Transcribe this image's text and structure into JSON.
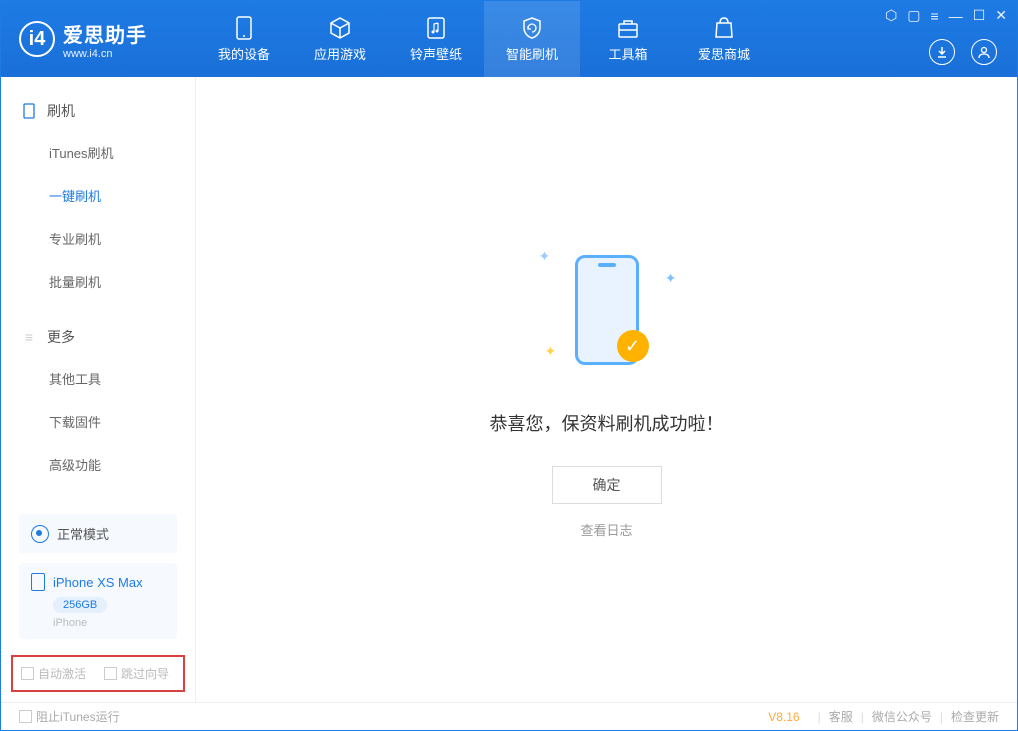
{
  "logo": {
    "title": "爱思助手",
    "subtitle": "www.i4.cn",
    "badge": "i4"
  },
  "nav": {
    "items": [
      {
        "label": "我的设备"
      },
      {
        "label": "应用游戏"
      },
      {
        "label": "铃声壁纸"
      },
      {
        "label": "智能刷机"
      },
      {
        "label": "工具箱"
      },
      {
        "label": "爱思商城"
      }
    ]
  },
  "sidebar": {
    "group1": {
      "title": "刷机",
      "items": [
        {
          "label": "iTunes刷机"
        },
        {
          "label": "一键刷机"
        },
        {
          "label": "专业刷机"
        },
        {
          "label": "批量刷机"
        }
      ]
    },
    "group2": {
      "title": "更多",
      "items": [
        {
          "label": "其他工具"
        },
        {
          "label": "下载固件"
        },
        {
          "label": "高级功能"
        }
      ]
    },
    "mode": "正常模式",
    "device": {
      "name": "iPhone XS Max",
      "storage": "256GB",
      "type": "iPhone"
    },
    "checks": {
      "auto_activate": "自动激活",
      "skip_guide": "跳过向导"
    }
  },
  "main": {
    "success": "恭喜您，保资料刷机成功啦！",
    "ok": "确定",
    "log_link": "查看日志"
  },
  "footer": {
    "block_itunes": "阻止iTunes运行",
    "version": "V8.16",
    "links": {
      "service": "客服",
      "wechat": "微信公众号",
      "update": "检查更新"
    }
  }
}
